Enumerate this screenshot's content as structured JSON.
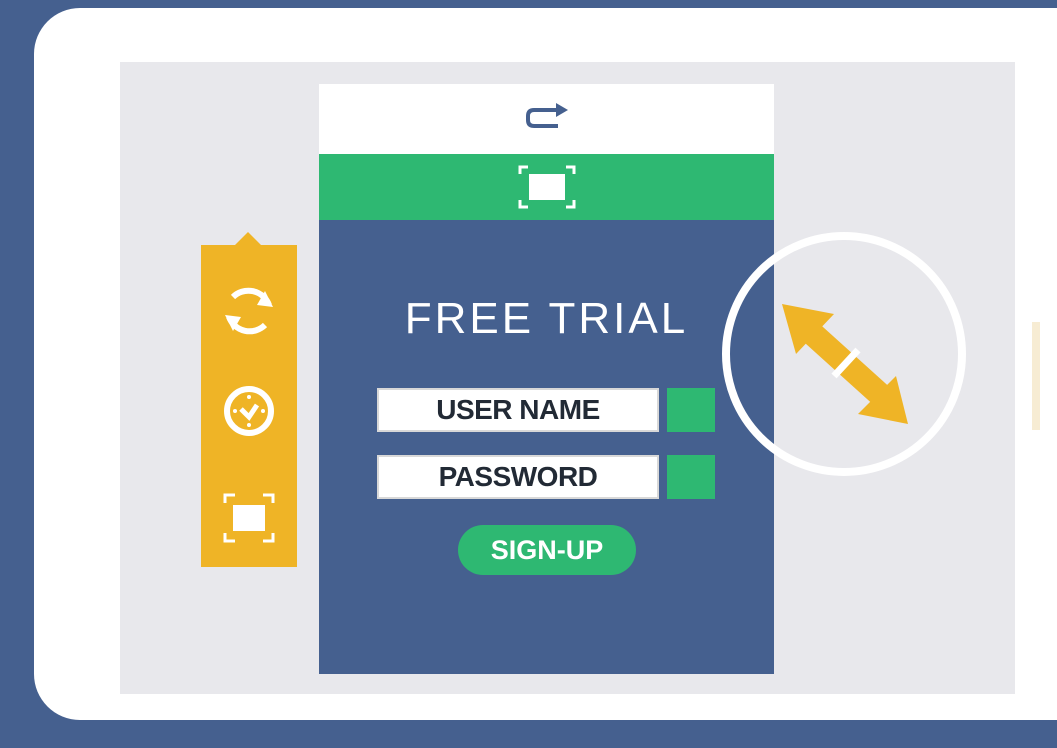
{
  "colors": {
    "frame": "#45608f",
    "device": "#ffffff",
    "screen": "#e8e8ec",
    "accent_yellow": "#efb426",
    "accent_green": "#2eb872",
    "panel_blue": "#45608f"
  },
  "side_toolbar": {
    "icons": [
      "refresh-icon",
      "clock-icon",
      "fullscreen-icon"
    ]
  },
  "panel": {
    "top_icon": "loop-arrow-icon",
    "green_bar_icon": "fullscreen-icon",
    "title": "FREE TRIAL",
    "fields": {
      "username_label": "USER NAME",
      "password_label": "PASSWORD"
    },
    "signup_label": "SIGN-UP"
  },
  "resize_indicator": {
    "icon": "diagonal-resize-arrow-icon"
  }
}
